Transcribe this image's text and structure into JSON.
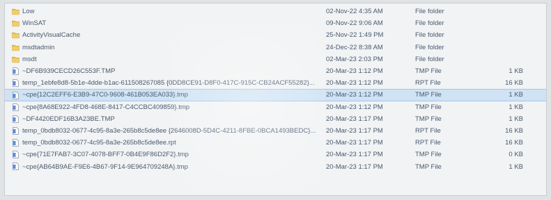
{
  "file_list": {
    "rows": [
      {
        "name": "Low",
        "date": "02-Nov-22 4:35 AM",
        "type": "File folder",
        "size": "",
        "icon": "folder-icon",
        "selected": false
      },
      {
        "name": "WinSAT",
        "date": "09-Nov-22 9:06 AM",
        "type": "File folder",
        "size": "",
        "icon": "folder-icon",
        "selected": false
      },
      {
        "name": "ActivityVisualCache",
        "date": "25-Nov-22 1:49 PM",
        "type": "File folder",
        "size": "",
        "icon": "folder-icon",
        "selected": false
      },
      {
        "name": "msdtadmin",
        "date": "24-Dec-22 8:38 AM",
        "type": "File folder",
        "size": "",
        "icon": "folder-icon",
        "selected": false
      },
      {
        "name": "msdt",
        "date": "02-Mar-23 2:03 PM",
        "type": "File folder",
        "size": "",
        "icon": "folder-icon",
        "selected": false
      },
      {
        "name": "~DF6B939CECD26C553F.TMP",
        "date": "20-Mar-23 1:12 PM",
        "type": "TMP File",
        "size": "1 KB",
        "icon": "file-icon",
        "selected": false
      },
      {
        "name": "temp_1ebfe8d8-5b1e-4dde-b1ac-611508267085 {0DD8CE91-D8F0-417C-915C-CB24ACF55282}...",
        "date": "20-Mar-23 1:12 PM",
        "type": "RPT File",
        "size": "16 KB",
        "icon": "file-icon",
        "selected": false
      },
      {
        "name": "~cpe{12C2EFF6-E3B9-47C0-9608-461B053EA033}.tmp",
        "date": "20-Mar-23 1:12 PM",
        "type": "TMP File",
        "size": "1 KB",
        "icon": "file-icon",
        "selected": true
      },
      {
        "name": "~cpe{8A68E922-4FD8-468E-8417-C4CCBC409859}.tmp",
        "date": "20-Mar-23 1:12 PM",
        "type": "TMP File",
        "size": "1 KB",
        "icon": "file-icon",
        "selected": false
      },
      {
        "name": "~DF4420EDF16B3A23BE.TMP",
        "date": "20-Mar-23 1:17 PM",
        "type": "TMP File",
        "size": "1 KB",
        "icon": "file-icon",
        "selected": false
      },
      {
        "name": "temp_0bdb8032-0677-4c95-8a3e-265b8c5de8ee {2646008D-5D4C-4211-8FBE-0BCA1493BEDC}...",
        "date": "20-Mar-23 1:17 PM",
        "type": "RPT File",
        "size": "16 KB",
        "icon": "file-icon",
        "selected": false
      },
      {
        "name": "temp_0bdb8032-0677-4c95-8a3e-265b8c5de8ee.rpt",
        "date": "20-Mar-23 1:17 PM",
        "type": "RPT File",
        "size": "16 KB",
        "icon": "file-icon",
        "selected": false
      },
      {
        "name": "~cpe{71E7FAB7-3C07-4078-BFF7-0B4E9F86D2F2}.tmp",
        "date": "20-Mar-23 1:17 PM",
        "type": "TMP File",
        "size": "0 KB",
        "icon": "file-icon",
        "selected": false
      },
      {
        "name": "~cpe{AB64B9AE-F9E6-4B67-9F14-9E964709248A}.tmp",
        "date": "20-Mar-23 1:17 PM",
        "type": "TMP File",
        "size": "1 KB",
        "icon": "file-icon",
        "selected": false
      }
    ]
  },
  "colors": {
    "selection": "#cfe3f4",
    "folder": "#e6c25a",
    "file": "#4a78c8",
    "text": "#49596e"
  }
}
